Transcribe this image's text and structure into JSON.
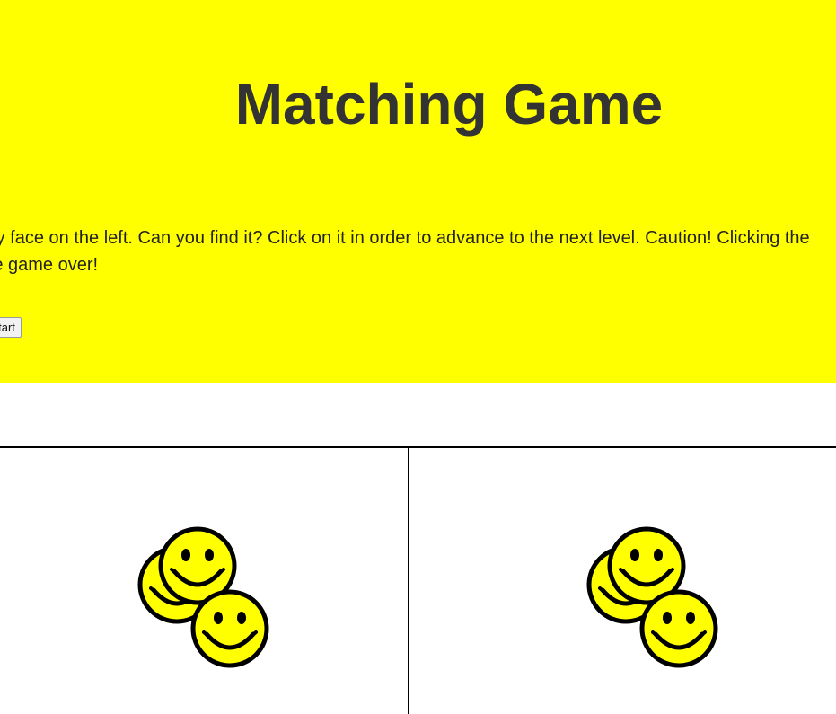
{
  "title": "Matching Game",
  "instructions": "Click on the extra smily face on the left. Can you find it? Click on it in order to advance to the next level. Caution! Clicking the wrong face will end the game over!",
  "restart_button": "Restart",
  "colors": {
    "header_bg": "#ffff00",
    "face_fill": "#ffff00",
    "face_stroke": "#000000",
    "divider": "#000000"
  },
  "left_side": {
    "face_count": 3
  },
  "right_side": {
    "face_count": 3
  }
}
